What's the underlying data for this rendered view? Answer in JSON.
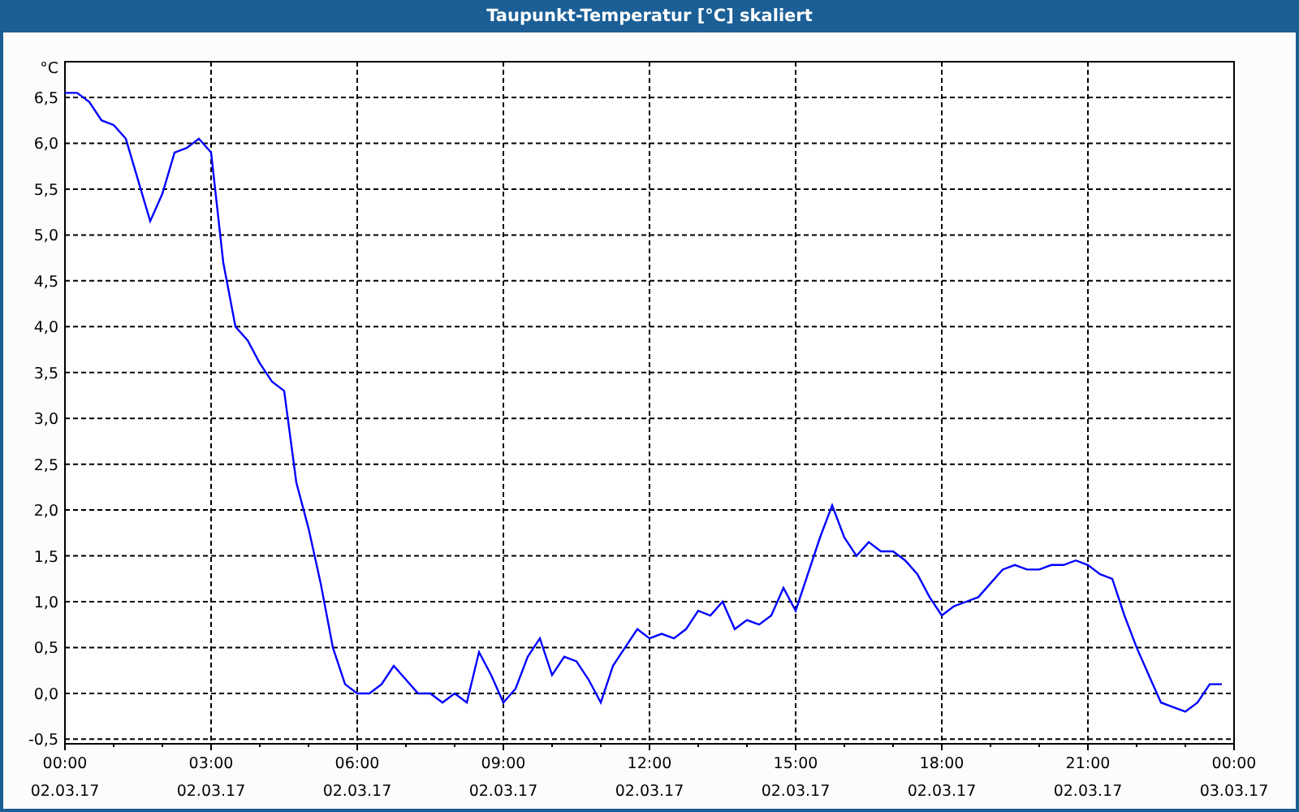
{
  "window": {
    "title": "Taupunkt-Temperatur [°C] skaliert"
  },
  "chart": {
    "date_labels": [
      "02.03.17",
      "02.03.17",
      "02.03.17",
      "02.03.17",
      "02.03.17",
      "02.03.17",
      "02.03.17",
      "02.03.17",
      "03.03.17"
    ],
    "chart_data": {
      "type": "line",
      "grid": true,
      "ylabel": "°C",
      "xlim": [
        0,
        24
      ],
      "ylim": [
        -0.55,
        6.89
      ],
      "xticks": [
        {
          "value": 0,
          "label": "00:00"
        },
        {
          "value": 3,
          "label": "03:00"
        },
        {
          "value": 6,
          "label": "06:00"
        },
        {
          "value": 9,
          "label": "09:00"
        },
        {
          "value": 12,
          "label": "12:00"
        },
        {
          "value": 15,
          "label": "15:00"
        },
        {
          "value": 18,
          "label": "18:00"
        },
        {
          "value": 21,
          "label": "21:00"
        },
        {
          "value": 24,
          "label": "00:00"
        }
      ],
      "yticks": [
        {
          "value": -0.5,
          "label": "-0,5"
        },
        {
          "value": 0,
          "label": "0,0"
        },
        {
          "value": 0.5,
          "label": "0,5"
        },
        {
          "value": 1,
          "label": "1,0"
        },
        {
          "value": 1.5,
          "label": "1,5"
        },
        {
          "value": 2,
          "label": "2,0"
        },
        {
          "value": 2.5,
          "label": "2,5"
        },
        {
          "value": 3,
          "label": "3,0"
        },
        {
          "value": 3.5,
          "label": "3,5"
        },
        {
          "value": 4,
          "label": "4,0"
        },
        {
          "value": 4.5,
          "label": "4,5"
        },
        {
          "value": 5,
          "label": "5,0"
        },
        {
          "value": 5.5,
          "label": "5,5"
        },
        {
          "value": 6,
          "label": "6,0"
        },
        {
          "value": 6.5,
          "label": "6,5"
        }
      ],
      "x": [
        0,
        0.25,
        0.5,
        0.75,
        1,
        1.25,
        1.5,
        1.75,
        2,
        2.25,
        2.5,
        2.75,
        3,
        3.25,
        3.5,
        3.75,
        4,
        4.25,
        4.5,
        4.75,
        5,
        5.25,
        5.5,
        5.75,
        6,
        6.25,
        6.5,
        6.75,
        7,
        7.25,
        7.5,
        7.75,
        8,
        8.25,
        8.5,
        8.75,
        9,
        9.25,
        9.5,
        9.75,
        10,
        10.25,
        10.5,
        10.75,
        11,
        11.25,
        11.5,
        11.75,
        12,
        12.25,
        12.5,
        12.75,
        13,
        13.25,
        13.5,
        13.75,
        14,
        14.25,
        14.5,
        14.75,
        15,
        15.25,
        15.5,
        15.75,
        16,
        16.25,
        16.5,
        16.75,
        17,
        17.25,
        17.5,
        17.75,
        18,
        18.25,
        18.5,
        18.75,
        19,
        19.25,
        19.5,
        19.75,
        20,
        20.25,
        20.5,
        20.75,
        21,
        21.25,
        21.5,
        21.75,
        22,
        22.25,
        22.5,
        22.75,
        23,
        23.25,
        23.5,
        23.75
      ],
      "series": [
        {
          "color": "#0000ff",
          "values": [
            6.55,
            6.55,
            6.45,
            6.25,
            6.2,
            6.05,
            5.6,
            5.15,
            5.45,
            5.9,
            5.95,
            6.05,
            5.9,
            4.7,
            4.0,
            3.85,
            3.6,
            3.4,
            3.3,
            2.3,
            1.8,
            1.2,
            0.5,
            0.1,
            0.0,
            0.0,
            0.1,
            0.3,
            0.15,
            0.0,
            0.0,
            -0.1,
            0.0,
            -0.1,
            0.45,
            0.2,
            -0.1,
            0.05,
            0.4,
            0.6,
            0.2,
            0.4,
            0.35,
            0.15,
            -0.1,
            0.3,
            0.5,
            0.7,
            0.6,
            0.65,
            0.6,
            0.7,
            0.9,
            0.85,
            1.0,
            0.7,
            0.8,
            0.75,
            0.85,
            1.15,
            0.9,
            1.3,
            1.7,
            2.05,
            1.7,
            1.5,
            1.65,
            1.55,
            1.55,
            1.45,
            1.3,
            1.05,
            0.85,
            0.95,
            1.0,
            1.05,
            1.2,
            1.35,
            1.4,
            1.35,
            1.35,
            1.4,
            1.4,
            1.45,
            1.4,
            1.3,
            1.25,
            0.85,
            0.5,
            0.2,
            -0.1,
            -0.15,
            -0.2,
            -0.1,
            0.1,
            0.1
          ]
        }
      ]
    }
  }
}
